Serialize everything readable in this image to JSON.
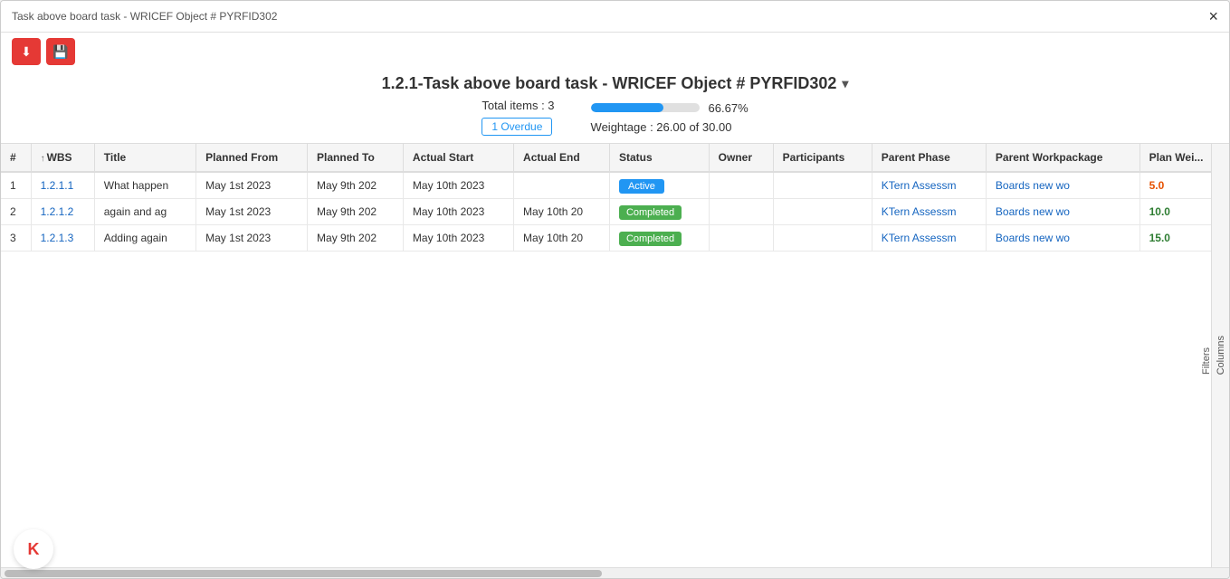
{
  "window": {
    "title": "Task above board task - WRICEF Object # PYRFID302",
    "close_label": "×"
  },
  "toolbar": {
    "btn1_icon": "⬇",
    "btn2_icon": "💾"
  },
  "header": {
    "title": "1.2.1-Task above board task - WRICEF Object # PYRFID302",
    "dropdown_icon": "▾",
    "total_items_label": "Total items : 3",
    "overdue_label": "1 Overdue",
    "progress_pct": "66.67%",
    "weightage_label": "Weightage : 26.00 of 30.00"
  },
  "progress": {
    "fill_pct": 66.67
  },
  "table": {
    "columns": [
      {
        "key": "num",
        "label": "#"
      },
      {
        "key": "wbs",
        "label": "↑ WBS"
      },
      {
        "key": "title",
        "label": "Title"
      },
      {
        "key": "planned_from",
        "label": "Planned From"
      },
      {
        "key": "planned_to",
        "label": "Planned To"
      },
      {
        "key": "actual_start",
        "label": "Actual Start"
      },
      {
        "key": "actual_end",
        "label": "Actual End"
      },
      {
        "key": "status",
        "label": "Status"
      },
      {
        "key": "owner",
        "label": "Owner"
      },
      {
        "key": "participants",
        "label": "Participants"
      },
      {
        "key": "parent_phase",
        "label": "Parent Phase"
      },
      {
        "key": "parent_workpackage",
        "label": "Parent Workpackage"
      },
      {
        "key": "plan_weight",
        "label": "Plan Wei..."
      }
    ],
    "rows": [
      {
        "num": "1",
        "wbs": "1.2.1.1",
        "title": "What happen",
        "planned_from": "May 1st 2023",
        "planned_to": "May 9th 202",
        "actual_start": "May 10th 2023",
        "actual_end": "",
        "status": "Active",
        "status_type": "active",
        "owner": "",
        "participants": "",
        "parent_phase": "KTern Assessm",
        "parent_workpackage": "Boards new wo",
        "plan_weight": "5.0"
      },
      {
        "num": "2",
        "wbs": "1.2.1.2",
        "title": "again and ag",
        "planned_from": "May 1st 2023",
        "planned_to": "May 9th 202",
        "actual_start": "May 10th 2023",
        "actual_end": "May 10th 20",
        "status": "Completed",
        "status_type": "completed",
        "owner": "",
        "participants": "",
        "parent_phase": "KTern Assessm",
        "parent_workpackage": "Boards new wo",
        "plan_weight": "10.0"
      },
      {
        "num": "3",
        "wbs": "1.2.1.3",
        "title": "Adding again",
        "planned_from": "May 1st 2023",
        "planned_to": "May 9th 202",
        "actual_start": "May 10th 2023",
        "actual_end": "May 10th 20",
        "status": "Completed",
        "status_type": "completed",
        "owner": "",
        "participants": "",
        "parent_phase": "KTern Assessm",
        "parent_workpackage": "Boards new wo",
        "plan_weight": "15.0"
      }
    ]
  },
  "side_panel": {
    "columns_label": "Columns",
    "filters_label": "Filters"
  }
}
